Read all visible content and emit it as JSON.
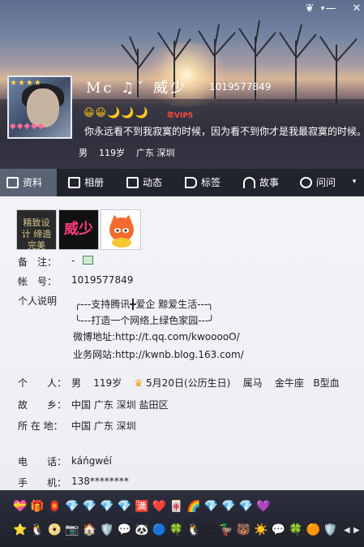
{
  "window": {
    "minimize": "—",
    "close": "✕",
    "skin": "❦",
    "arrow": "▾"
  },
  "profile": {
    "nickname": "Mc ♫ˇ 威少",
    "qq_number": "1019577849",
    "emoticons": "😀😀🌙🌙🌙",
    "vip_badge": "年VIP5",
    "signature": "你永远看不到我寂寞的时候，因为看不到你才是我最寂寞的时候。",
    "gender": "男",
    "age": "119岁",
    "location": "广东 深圳",
    "avatar_badges_top": "★★★★",
    "avatar_badges_bottom": "◆◆◆◆◆"
  },
  "tabs": [
    {
      "label": "资料",
      "icon": "profile-icon"
    },
    {
      "label": "相册",
      "icon": "album-icon"
    },
    {
      "label": "动态",
      "icon": "feed-icon"
    },
    {
      "label": "标签",
      "icon": "tag-icon"
    },
    {
      "label": "故事",
      "icon": "story-icon"
    },
    {
      "label": "问问",
      "icon": "question-icon"
    }
  ],
  "tab_more": "▾",
  "pictures": [
    {
      "caption": "精致设计 缔造完美",
      "name": "design-badge"
    },
    {
      "caption": "威少",
      "name": "name-badge"
    },
    {
      "caption": "",
      "name": "fox-badge"
    }
  ],
  "details": {
    "remark_label": "备　注：",
    "remark_value": "-",
    "account_label": "帐　号：",
    "account_value": "1019577849",
    "desc_label": "个人说明",
    "desc_lines": [
      "╭---支持腾讯╋爱企 黥爱生活---╮",
      "╰---打造一个网络上绿色家园---╯",
      "微博地址:http://t.qq.com/kwooooO/",
      "业务网站:http://kwnb.blog.163.com/"
    ],
    "person_label": "个　　人：",
    "person_gender": "男",
    "person_age": "119岁",
    "person_birthday": "5月20日(公历生日)",
    "person_zodiac": "属马",
    "person_sign": "金牛座",
    "person_blood": "B型血",
    "hometown_label": "故　　乡：",
    "hometown_value": "中国 广东 深圳 盐田区",
    "residence_label": "所 在 地：",
    "residence_value": "中国 广东 深圳",
    "phone_label": "电　　话：",
    "phone_value": "káńgwéí",
    "mobile_label": "手　　机：",
    "mobile_value": "138********"
  },
  "bottom": {
    "row1": "💝🎁🏮💎💎💎💎🈵❤️🀄🌈💎💎💎💜",
    "row2": "⭐🐧📀📷🏠🛡️💬🐼🔵🍀🐧😶🦆🐻☀️💬🍀🟠🛡️",
    "left_arrow": "◀",
    "right_arrow": "▶"
  }
}
